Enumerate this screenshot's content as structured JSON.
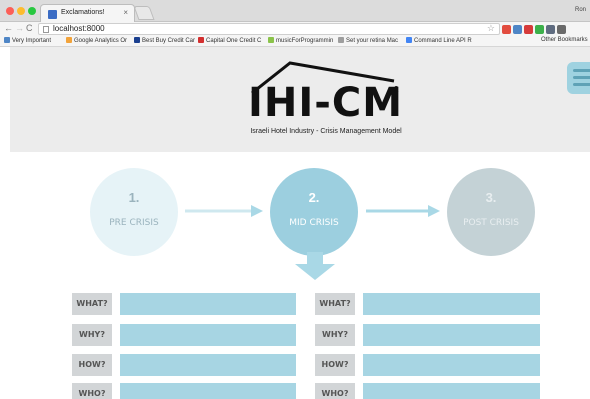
{
  "browser": {
    "tab_title": "Exclamations!",
    "tab_close": "×",
    "profile_label": "Ron",
    "url": "localhost:8000",
    "nav": {
      "back": "←",
      "forward": "→",
      "reload": "C"
    },
    "star": "☆",
    "extension_colors": [
      "#e24c3f",
      "#4f86c6",
      "#d63b3b",
      "#3cb04a",
      "#5f6c80",
      "#6a6a6a"
    ],
    "bookmarks": [
      {
        "label": "Very Important",
        "color": "#4f86c6"
      },
      {
        "label": "Google Analytics Or",
        "color": "#f2a33a"
      },
      {
        "label": "Best Buy Credit Car",
        "color": "#1a3f8f"
      },
      {
        "label": "Capital One Credit C",
        "color": "#d32f2f"
      },
      {
        "label": "musicForProgrammin",
        "color": "#8bc34a"
      },
      {
        "label": "Set your retina Mac",
        "color": "#9e9e9e"
      },
      {
        "label": "Command Line API R",
        "color": "#4285f4"
      }
    ],
    "other_bookmarks": "Other Bookmarks"
  },
  "page": {
    "logo": {
      "text": "IHI-CM",
      "superscript": "2",
      "subtitle": "Israeli Hotel Industry - Crisis Management Model"
    },
    "stages": [
      {
        "number": "1.",
        "label": "PRE CRISIS"
      },
      {
        "number": "2.",
        "label": "MID CRISIS"
      },
      {
        "number": "3.",
        "label": "POST CRISIS"
      }
    ],
    "questions_left": [
      "WHAT?",
      "WHY?",
      "HOW?",
      "WHO?"
    ],
    "questions_right": [
      "WHAT?",
      "WHY?",
      "HOW?",
      "WHO?"
    ]
  },
  "colors": {
    "accent": "#9ccfdf",
    "field": "#a7d5e3",
    "arrow": "#a9d8e6",
    "label_bg": "#d2d5d7",
    "header_bg": "#ececec"
  }
}
